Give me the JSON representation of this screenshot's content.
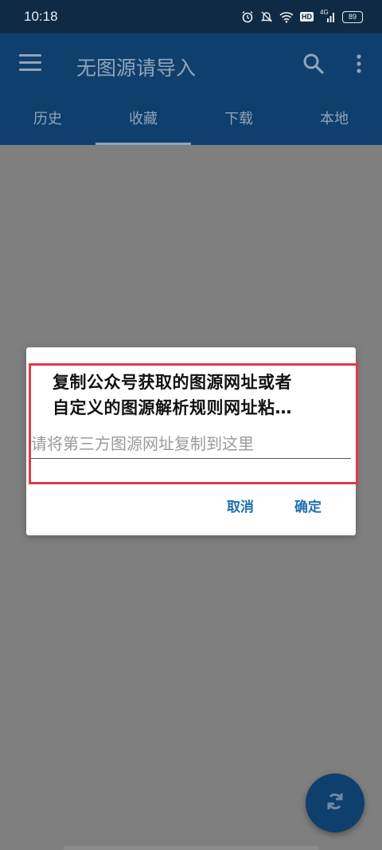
{
  "status_bar": {
    "time": "10:18",
    "icons": [
      "alarm-icon",
      "mute-icon",
      "wifi-icon",
      "hd-icon",
      "signal-icon",
      "battery-icon"
    ],
    "hd_label": "HD",
    "network_label": "4G",
    "battery_level": "89"
  },
  "app_bar": {
    "title": "无图源请导入",
    "icons": [
      "menu-icon",
      "search-icon",
      "more-vert-icon"
    ],
    "tabs": [
      {
        "label": "历史",
        "active": false
      },
      {
        "label": "收藏",
        "active": true
      },
      {
        "label": "下载",
        "active": false
      },
      {
        "label": "本地",
        "active": false
      }
    ]
  },
  "dialog": {
    "message_line1": "复制公众号获取的图源网址或者",
    "message_line2": "自定义的图源解析规则网址粘…",
    "input_value": "",
    "input_placeholder": "请将第三方图源网址复制到这里",
    "cancel_label": "取消",
    "ok_label": "确定"
  },
  "fab": {
    "icon": "sync-icon"
  },
  "colors": {
    "app_bar": "#0f3f6d",
    "status_bar": "#0e2a44",
    "scrim": "#7f7f7f",
    "accent_button": "#1f6fb2",
    "highlight": "#e03a4a"
  }
}
